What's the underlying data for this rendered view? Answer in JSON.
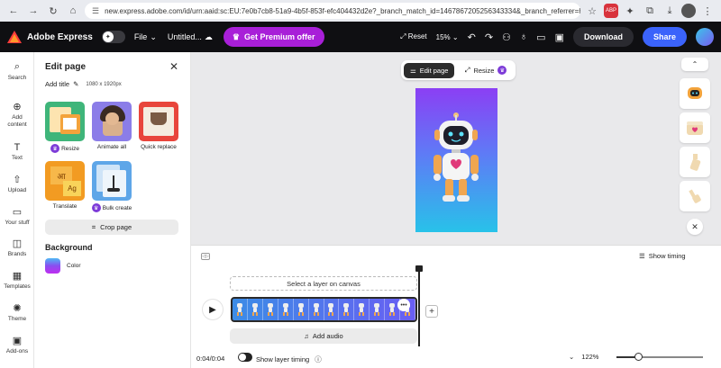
{
  "browser": {
    "url": "new.express.adobe.com/id/urn:aaid:sc:EU:7e0b7cb8-51a9-4b5f-853f-efc404432d2e?_branch_match_id=1467867205256343334&_branch_referrer=H4sIAA..."
  },
  "header": {
    "app_name": "Adobe Express",
    "file_label": "File",
    "doc_title": "Untitled...",
    "premium_label": "Get Premium offer",
    "reset_label": "Reset",
    "zoom": "15%",
    "download_label": "Download",
    "share_label": "Share"
  },
  "rail": [
    {
      "label": "Search",
      "icon": "search-icon"
    },
    {
      "label": "Add content",
      "icon": "plus-circle-icon"
    },
    {
      "label": "Text",
      "icon": "text-icon"
    },
    {
      "label": "Upload",
      "icon": "upload-icon"
    },
    {
      "label": "Your stuff",
      "icon": "folder-icon"
    },
    {
      "label": "Brands",
      "icon": "brand-icon"
    },
    {
      "label": "Templates",
      "icon": "templates-icon"
    },
    {
      "label": "Theme",
      "icon": "theme-icon"
    },
    {
      "label": "Add-ons",
      "icon": "addons-icon"
    }
  ],
  "panel": {
    "title": "Edit page",
    "add_title": "Add title",
    "dimensions": "1080 x 1920px",
    "tools": [
      {
        "label": "Resize",
        "premium": true
      },
      {
        "label": "Animate all",
        "premium": false
      },
      {
        "label": "Quick replace",
        "premium": false
      },
      {
        "label": "Translate",
        "premium": false
      },
      {
        "label": "Bulk create",
        "premium": true
      }
    ],
    "crop_label": "Crop page",
    "background_title": "Background",
    "color_label": "Color"
  },
  "canvas": {
    "toolbar": {
      "edit_page": "Edit page",
      "resize": "Resize"
    }
  },
  "timeline": {
    "show_timing": "Show timing",
    "select_layer": "Select a layer on canvas",
    "add_audio": "Add audio",
    "timecode": "0:04/0:04",
    "show_layer_timing": "Show layer timing",
    "zoom": "122%",
    "zoom_level": 0.25
  },
  "colors": {
    "premium": "#a81fd8",
    "share": "#3b63fb",
    "header_bg": "#0f0f12"
  }
}
